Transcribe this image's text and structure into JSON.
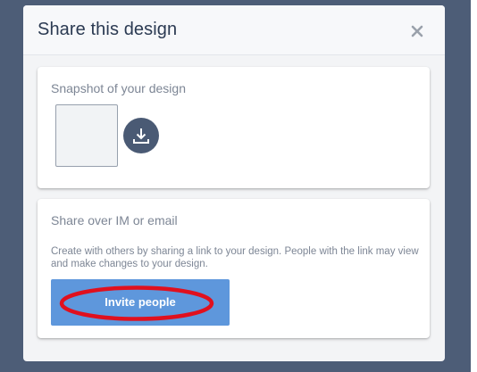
{
  "modal": {
    "title": "Share this design",
    "close_icon": "close-icon"
  },
  "snapshot": {
    "heading": "Snapshot of your design",
    "download_icon": "download-icon"
  },
  "share": {
    "heading": "Share over IM or email",
    "description": "Create with others by sharing a link to your design. People with the link may view and make changes to your design.",
    "invite_label": "Invite people"
  },
  "colors": {
    "backdrop": "#4d5d77",
    "accent_button": "#5e97dc",
    "annotation_circle": "#e0101e",
    "download_button": "#4a5a74"
  }
}
